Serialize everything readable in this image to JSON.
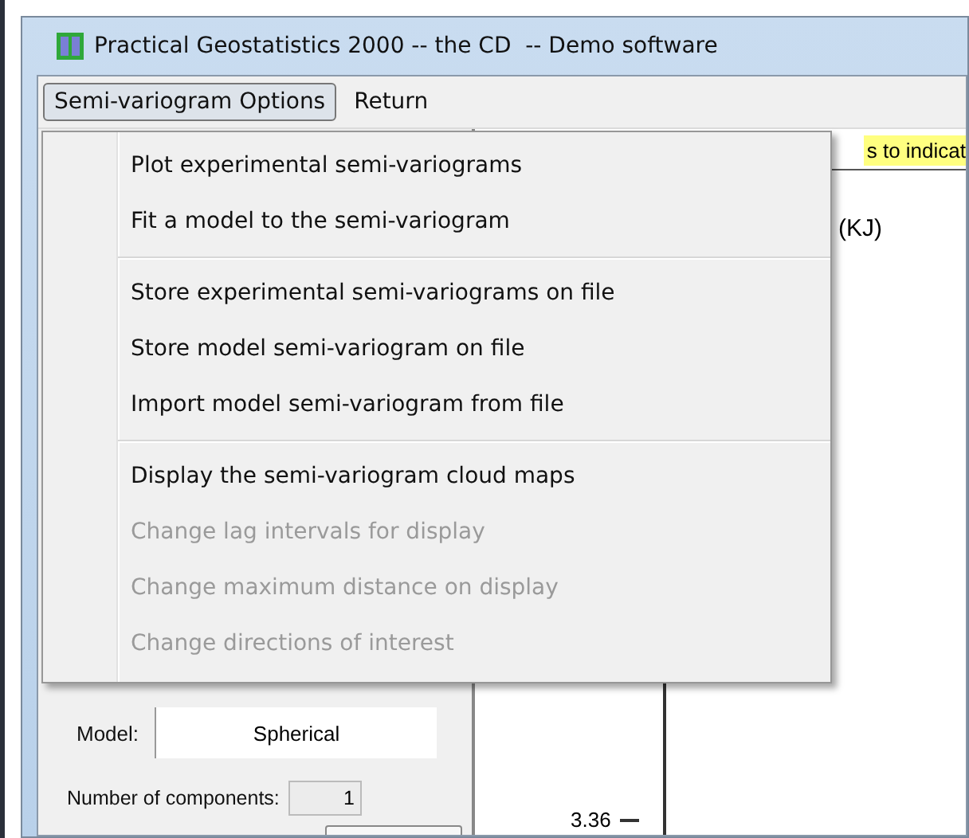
{
  "window": {
    "title": "Practical Geostatistics 2000 -- the CD  -- Demo software"
  },
  "menubar": [
    {
      "label": "Semi-variogram Options",
      "selected": true
    },
    {
      "label": "Return",
      "selected": false
    }
  ],
  "menu": {
    "groups": [
      [
        {
          "label": "Plot experimental semi-variograms",
          "disabled": false
        },
        {
          "label": "Fit a model to the semi-variogram",
          "disabled": false
        }
      ],
      [
        {
          "label": "Store experimental semi-variograms on file",
          "disabled": false
        },
        {
          "label": "Store model semi-variogram on file",
          "disabled": false
        },
        {
          "label": "Import model semi-variogram from file",
          "disabled": false
        }
      ],
      [
        {
          "label": "Display the semi-variogram cloud maps",
          "disabled": false
        },
        {
          "label": "Change lag intervals for display",
          "disabled": true
        },
        {
          "label": "Change maximum distance on display",
          "disabled": true
        },
        {
          "label": "Change directions of interest",
          "disabled": true
        }
      ]
    ]
  },
  "hint": "s to indicat",
  "axis_label": "(KJ)",
  "model": {
    "label": "Model:",
    "value": "Spherical"
  },
  "components": {
    "label": "Number of components:",
    "value": "1"
  },
  "y_tick": "3.36"
}
